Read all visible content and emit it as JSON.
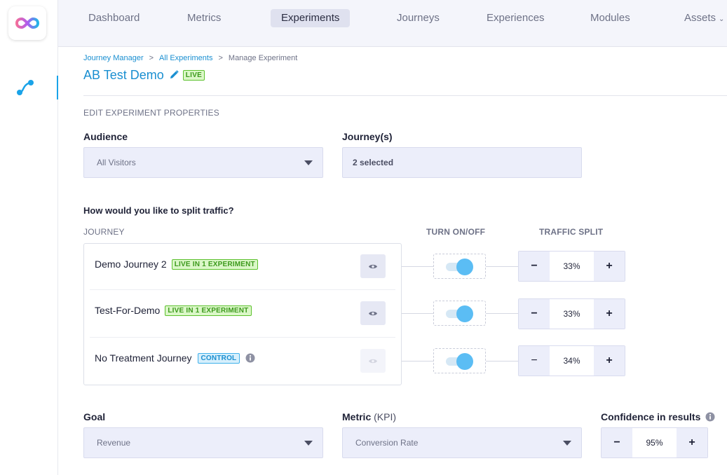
{
  "nav": {
    "tabs": [
      {
        "label": "Dashboard"
      },
      {
        "label": "Metrics"
      },
      {
        "label": "Experiments"
      },
      {
        "label": "Journeys"
      },
      {
        "label": "Experiences"
      },
      {
        "label": "Modules"
      },
      {
        "label": "Assets"
      }
    ],
    "active_tab": "Experiments"
  },
  "breadcrumb": {
    "items": [
      "Journey Manager",
      "All Experiments",
      "Manage Experiment"
    ],
    "separator": ">"
  },
  "title": "AB Test Demo",
  "status_badge": "LIVE",
  "section_title": "EDIT EXPERIMENT PROPERTIES",
  "audience": {
    "label": "Audience",
    "value": "All Visitors"
  },
  "journeys_field": {
    "label": "Journey(s)",
    "value": "2 selected"
  },
  "split": {
    "question": "How would you like to split traffic?",
    "columns": {
      "journey": "JOURNEY",
      "toggle": "TURN ON/OFF",
      "traffic": "TRAFFIC SPLIT"
    },
    "rows": [
      {
        "name": "Demo Journey 2",
        "badge": "LIVE IN 1 EXPERIMENT",
        "badge_type": "live",
        "enabled": true,
        "traffic": "33%",
        "minus": "−",
        "plus": "+"
      },
      {
        "name": "Test-For-Demo",
        "badge": "LIVE IN 1 EXPERIMENT",
        "badge_type": "live",
        "enabled": true,
        "traffic": "33%",
        "minus": "−",
        "plus": "+"
      },
      {
        "name": "No Treatment Journey",
        "badge": "CONTROL",
        "badge_type": "control",
        "enabled": true,
        "traffic": "34%",
        "minus": "−",
        "plus": "+"
      }
    ]
  },
  "goal": {
    "label": "Goal",
    "value": "Revenue"
  },
  "metric": {
    "label": "Metric",
    "label_suffix": "(KPI)",
    "value": "Conversion Rate"
  },
  "confidence": {
    "label": "Confidence in results",
    "value": "95%",
    "minus": "−",
    "plus": "+"
  },
  "colors": {
    "accent": "#1a8fd1",
    "live": "#5cc12d",
    "control": "#3fb0ea",
    "toggle": "#5bbdf4"
  }
}
